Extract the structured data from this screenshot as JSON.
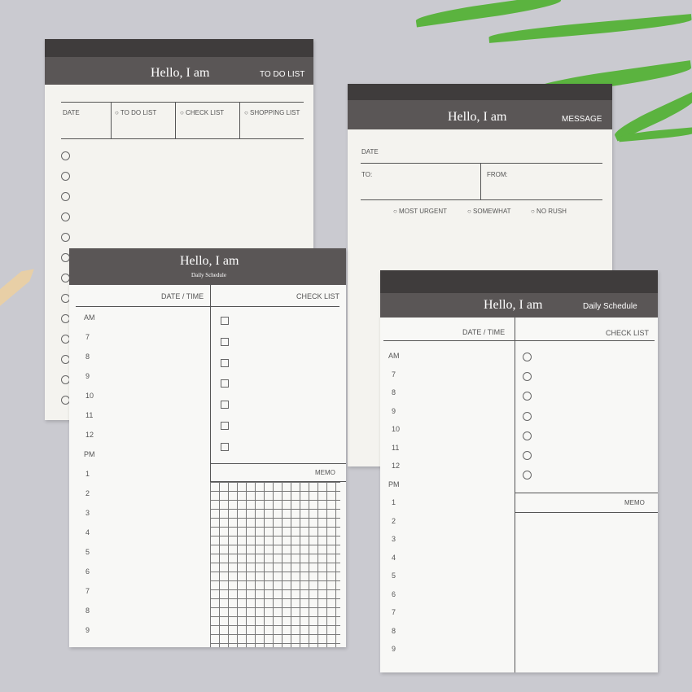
{
  "pad_todo": {
    "title": "Hello, I am",
    "tag": "TO DO LIST",
    "fields": [
      "DATE",
      "○ TO DO LIST",
      "○ CHECK LIST",
      "○ SHOPPING LIST"
    ],
    "circle_count": 13
  },
  "pad_message": {
    "title": "Hello, I am",
    "tag": "MESSAGE",
    "date": "DATE",
    "to": "TO:",
    "from": "FROM:",
    "options": [
      "○ MOST URGENT",
      "○ SOMEWHAT",
      "○ NO RUSH"
    ]
  },
  "pad_daily_left": {
    "title": "Hello, I am",
    "subtitle": "Daily Schedule",
    "date_time": "DATE / TIME",
    "check_list": "CHECK LIST",
    "memo": "MEMO",
    "times": [
      "AM",
      "7",
      "8",
      "9",
      "10",
      "11",
      "12",
      "PM",
      "1",
      "2",
      "3",
      "4",
      "5",
      "6",
      "7",
      "8",
      "9"
    ],
    "checkbox_count": 7
  },
  "pad_daily_right": {
    "title": "Hello, I am",
    "tag": "Daily Schedule",
    "date_time": "DATE / TIME",
    "check_list": "CHECK LIST",
    "memo": "MEMO",
    "times": [
      "AM",
      "7",
      "8",
      "9",
      "10",
      "11",
      "12",
      "PM",
      "1",
      "2",
      "3",
      "4",
      "5",
      "6",
      "7",
      "8",
      "9"
    ],
    "circle_count": 7
  },
  "colors": {
    "background": "#cacad0",
    "header": "#5a5656",
    "paper": "#f4f3ef",
    "leaf": "#5bb33f"
  }
}
